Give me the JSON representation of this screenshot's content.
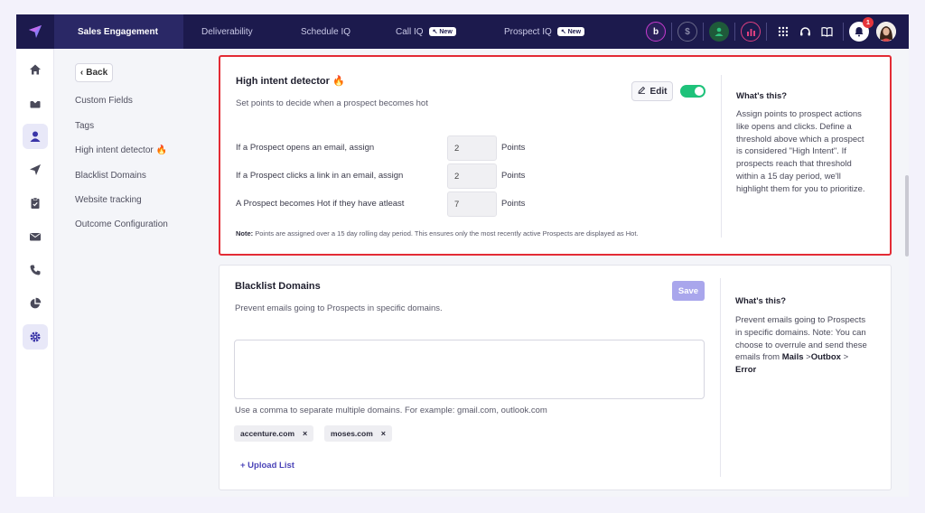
{
  "nav": {
    "tabs": [
      {
        "label": "Sales Engagement",
        "badge": ""
      },
      {
        "label": "Deliverability",
        "badge": ""
      },
      {
        "label": "Schedule IQ",
        "badge": ""
      },
      {
        "label": "Call IQ",
        "badge": "New"
      },
      {
        "label": "Prospect IQ",
        "badge": "New"
      }
    ],
    "notification_count": "1",
    "icons": [
      "logo-icon",
      "b-icon",
      "dollar-icon",
      "user-circle-icon",
      "chart-icon",
      "dialpad-icon",
      "headset-icon",
      "book-icon",
      "bell-icon",
      "profile-avatar"
    ]
  },
  "sidebar": {
    "icons": [
      "home-icon",
      "inbox-icon",
      "user-icon",
      "send-icon",
      "clipboard-icon",
      "mail-icon",
      "phone-icon",
      "pie-chart-icon",
      "settings-icon"
    ]
  },
  "subnav": {
    "back_label": "Back",
    "items": [
      "Custom Fields",
      "Tags",
      "High intent detector 🔥",
      "Blacklist Domains",
      "Website tracking",
      "Outcome Configuration"
    ]
  },
  "high_intent": {
    "title": "High intent detector 🔥",
    "subtitle": "Set points to decide when a prospect becomes hot",
    "edit_label": "Edit",
    "rules": [
      {
        "label": "If a Prospect opens an email, assign",
        "value": "2",
        "unit": "Points"
      },
      {
        "label": "If a Prospect clicks a link in an email, assign",
        "value": "2",
        "unit": "Points"
      },
      {
        "label": "A Prospect becomes Hot if they have atleast",
        "value": "7",
        "unit": "Points"
      }
    ],
    "note_label": "Note:",
    "note_text": " Points are assigned over a 15 day rolling day period. This ensures only the most recently active Prospects are displayed as Hot.",
    "help_title": "What's this?",
    "help_text": "Assign points to prospect actions like opens and clicks. Define a threshold above which a prospect is considered \"High Intent\". If prospects reach that threshold within a 15 day period, we'll highlight them for you to prioritize."
  },
  "blacklist": {
    "title": "Blacklist Domains",
    "subtitle": "Prevent emails going to Prospects in specific domains.",
    "save_label": "Save",
    "hint": "Use a comma to separate multiple domains. For example: gmail.com, outlook.com",
    "chips": [
      "accenture.com",
      "moses.com"
    ],
    "upload_label": "+ Upload List",
    "help_title": "What's this?",
    "help_text_1": "Prevent emails going to Prospects in specific domains. Note: You can choose to overrule and send these emails from ",
    "help_b1": "Mails",
    "help_mid": " >",
    "help_b2": "Outbox",
    "help_mid2": " >",
    "help_b3": "Error"
  },
  "colors": {
    "topbar": "#1c1a4d",
    "accent": "#4b44b8",
    "toggle_on": "#1ec27a",
    "highlight_border": "#e32b35"
  }
}
